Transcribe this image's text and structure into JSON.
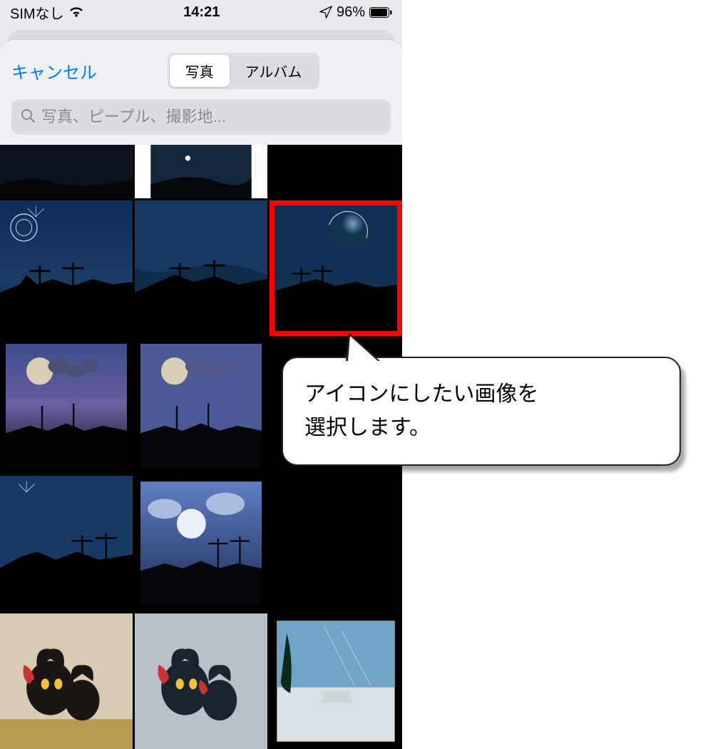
{
  "status": {
    "carrier": "SIMなし",
    "time": "14:21",
    "battery_pct": "96%"
  },
  "picker": {
    "cancel": "キャンセル",
    "tabs": {
      "photos": "写真",
      "albums": "アルバム"
    },
    "search_placeholder": "写真、ピープル、撮影地..."
  },
  "annotation": {
    "line1": "アイコンにしたい画像を",
    "line2": "選択します。"
  },
  "icons": {
    "wifi": "wifi-icon",
    "location": "location-icon",
    "battery": "battery-icon",
    "search": "search-icon"
  }
}
